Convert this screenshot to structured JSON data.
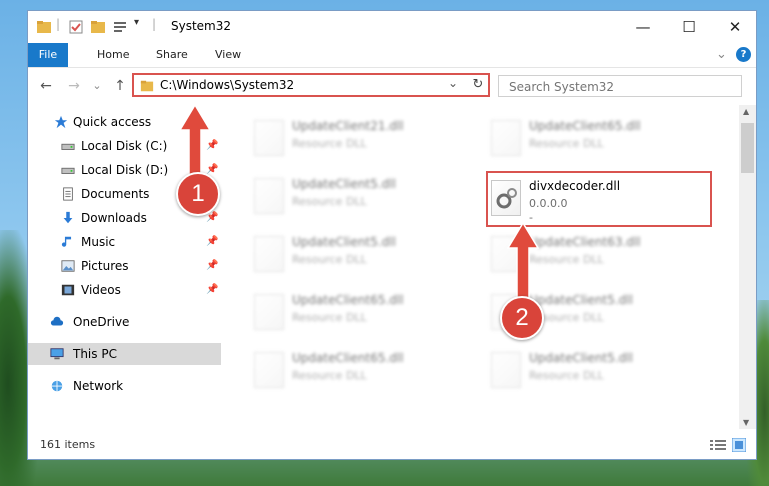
{
  "window": {
    "title": "System32",
    "minimize_glyph": "—",
    "maximize_glyph": "☐",
    "close_glyph": "✕"
  },
  "ribbon": {
    "tabs": [
      "File",
      "Home",
      "Share",
      "View"
    ],
    "expand_glyph": "⌄",
    "help_glyph": "?"
  },
  "nav": {
    "back_glyph": "←",
    "forward_glyph": "→",
    "recent_glyph": "⌄",
    "up_glyph": "↑",
    "address": "C:\\Windows\\System32",
    "dropdown_glyph": "⌄",
    "refresh_glyph": "↻",
    "search_placeholder": "Search System32"
  },
  "sidebar": {
    "items": [
      {
        "label": "Quick access",
        "icon": "star-icon",
        "pinned": false
      },
      {
        "label": "Local Disk (C:)",
        "icon": "drive-icon",
        "pinned": true
      },
      {
        "label": "Local Disk (D:)",
        "icon": "drive-icon",
        "pinned": true
      },
      {
        "label": "Documents",
        "icon": "documents-icon",
        "pinned": true
      },
      {
        "label": "Downloads",
        "icon": "download-icon",
        "pinned": true
      },
      {
        "label": "Music",
        "icon": "music-icon",
        "pinned": true
      },
      {
        "label": "Pictures",
        "icon": "pictures-icon",
        "pinned": true
      },
      {
        "label": "Videos",
        "icon": "videos-icon",
        "pinned": true
      },
      {
        "label": "OneDrive",
        "icon": "cloud-icon",
        "pinned": false
      },
      {
        "label": "This PC",
        "icon": "computer-icon",
        "pinned": false,
        "selected": true
      },
      {
        "label": "Network",
        "icon": "network-icon",
        "pinned": false
      }
    ],
    "pin_glyph": "📌"
  },
  "files": [
    {
      "name": "UpdateClient21.dll",
      "sub": "Resource DLL"
    },
    {
      "name": "UpdateClient65.dll",
      "sub": "Resource DLL"
    },
    {
      "name": "UpdateClient5.dll",
      "sub": "Resource DLL"
    },
    {
      "name": "divxdecoder.dll",
      "sub": "0.0.0.0",
      "sub2": "-",
      "highlighted": true
    },
    {
      "name": "UpdateClient5.dll",
      "sub": "Resource DLL"
    },
    {
      "name": "UpdateClient63.dll",
      "sub": "Resource DLL"
    },
    {
      "name": "UpdateClient65.dll",
      "sub": "Resource DLL"
    },
    {
      "name": "UpdateClient5.dll",
      "sub": "Resource DLL"
    },
    {
      "name": "UpdateClient65.dll",
      "sub": "Resource DLL"
    },
    {
      "name": "UpdateClient5.dll",
      "sub": "Resource DLL"
    }
  ],
  "status": {
    "item_count": "161 items"
  },
  "annotations": {
    "badge1": "1",
    "badge2": "2",
    "color": "#d9443a"
  },
  "colors": {
    "accent": "#1979ca",
    "highlight_border": "#d9534f",
    "selected_bg": "#cce8ff"
  }
}
